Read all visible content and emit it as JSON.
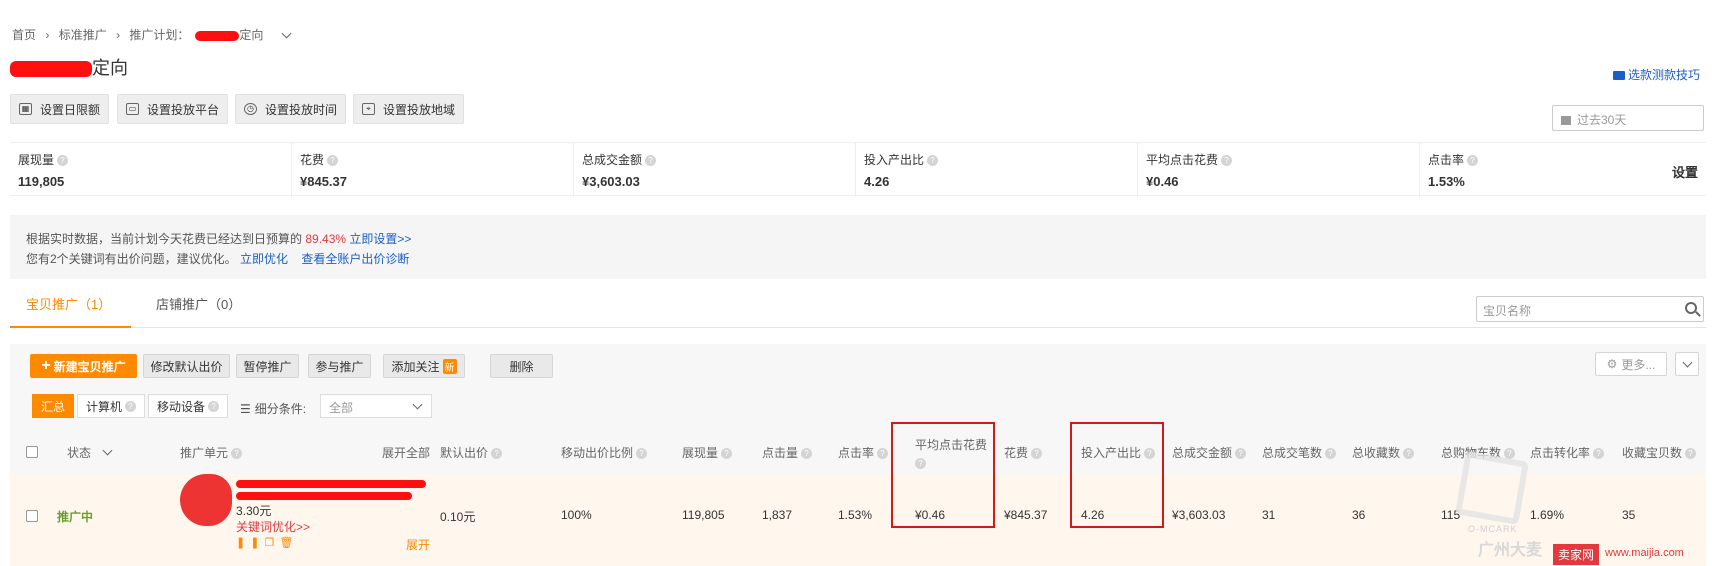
{
  "breadcrumb": {
    "home": "首页",
    "standard": "标准推广",
    "plan_prefix": "推广计划：",
    "plan_suffix": "定向"
  },
  "title_suffix": "定向",
  "tips_link": "选款测款技巧",
  "toolbar": {
    "daily_limit": "设置日限额",
    "platform": "设置投放平台",
    "time": "设置投放时间",
    "region": "设置投放地域"
  },
  "date_range": "过去30天",
  "kpis": [
    {
      "label": "展现量",
      "value": "119,805"
    },
    {
      "label": "花费",
      "value": "¥845.37"
    },
    {
      "label": "总成交金额",
      "value": "¥3,603.03"
    },
    {
      "label": "投入产出比",
      "value": "4.26"
    },
    {
      "label": "平均点击花费",
      "value": "¥0.46"
    },
    {
      "label": "点击率",
      "value": "1.53%"
    }
  ],
  "kpi_settings": "设置",
  "notice": {
    "line1_text": "根据实时数据，当前计划今天花费已经达到日预算的",
    "line1_pct": "89.43%",
    "line1_link": "立即设置>>",
    "line2_text": "您有2个关键词有出价问题，建议优化。",
    "line2_link1": "立即优化",
    "line2_link2": "查看全账户出价诊断"
  },
  "tabs": {
    "items": "宝贝推广（1）",
    "store": "店铺推广（0）"
  },
  "search_placeholder": "宝贝名称",
  "actions": {
    "new": "新建宝贝推广",
    "modify_bid": "修改默认出价",
    "pause": "暂停推广",
    "join": "参与推广",
    "watch": "添加关注",
    "new_badge": "新",
    "delete": "删除",
    "more": "更多..."
  },
  "device_tabs": {
    "summary": "汇总",
    "computer": "计算机",
    "mobile": "移动设备"
  },
  "segment_label": "细分条件:",
  "segment_value": "全部",
  "columns": {
    "status": "状态",
    "unit": "推广单元",
    "expand_all": "展开全部",
    "default_bid": "默认出价",
    "mobile_ratio": "移动出价比例",
    "impressions": "展现量",
    "clicks": "点击量",
    "ctr": "点击率",
    "cpc": "平均点击花费",
    "cost": "花费",
    "roi": "投入产出比",
    "gmv": "总成交金额",
    "orders": "总成交笔数",
    "fav": "总收藏数",
    "cart": "总购物车数",
    "cvr": "点击转化率",
    "fav_items": "收藏宝贝数"
  },
  "row": {
    "status": "推广中",
    "price": "3.30元",
    "optimize_link": "关键词优化>>",
    "expand": "展开",
    "default_bid": "0.10元",
    "mobile_ratio": "100%",
    "impressions": "119,805",
    "clicks": "1,837",
    "ctr": "1.53%",
    "cpc": "¥0.46",
    "cost": "¥845.37",
    "roi": "4.26",
    "gmv": "¥3,603.03",
    "orders": "31",
    "fav": "36",
    "cart": "115",
    "cvr": "1.69%",
    "fav_items": "35"
  },
  "watermark": {
    "logo_sub": "O-MCARK",
    "text": "广州大麦",
    "site_badge": "卖家网",
    "site_url": "www.maijia.com"
  },
  "colors": {
    "accent": "#ff8a00",
    "link": "#1a5fc7",
    "highlight": "#d11a1a"
  }
}
